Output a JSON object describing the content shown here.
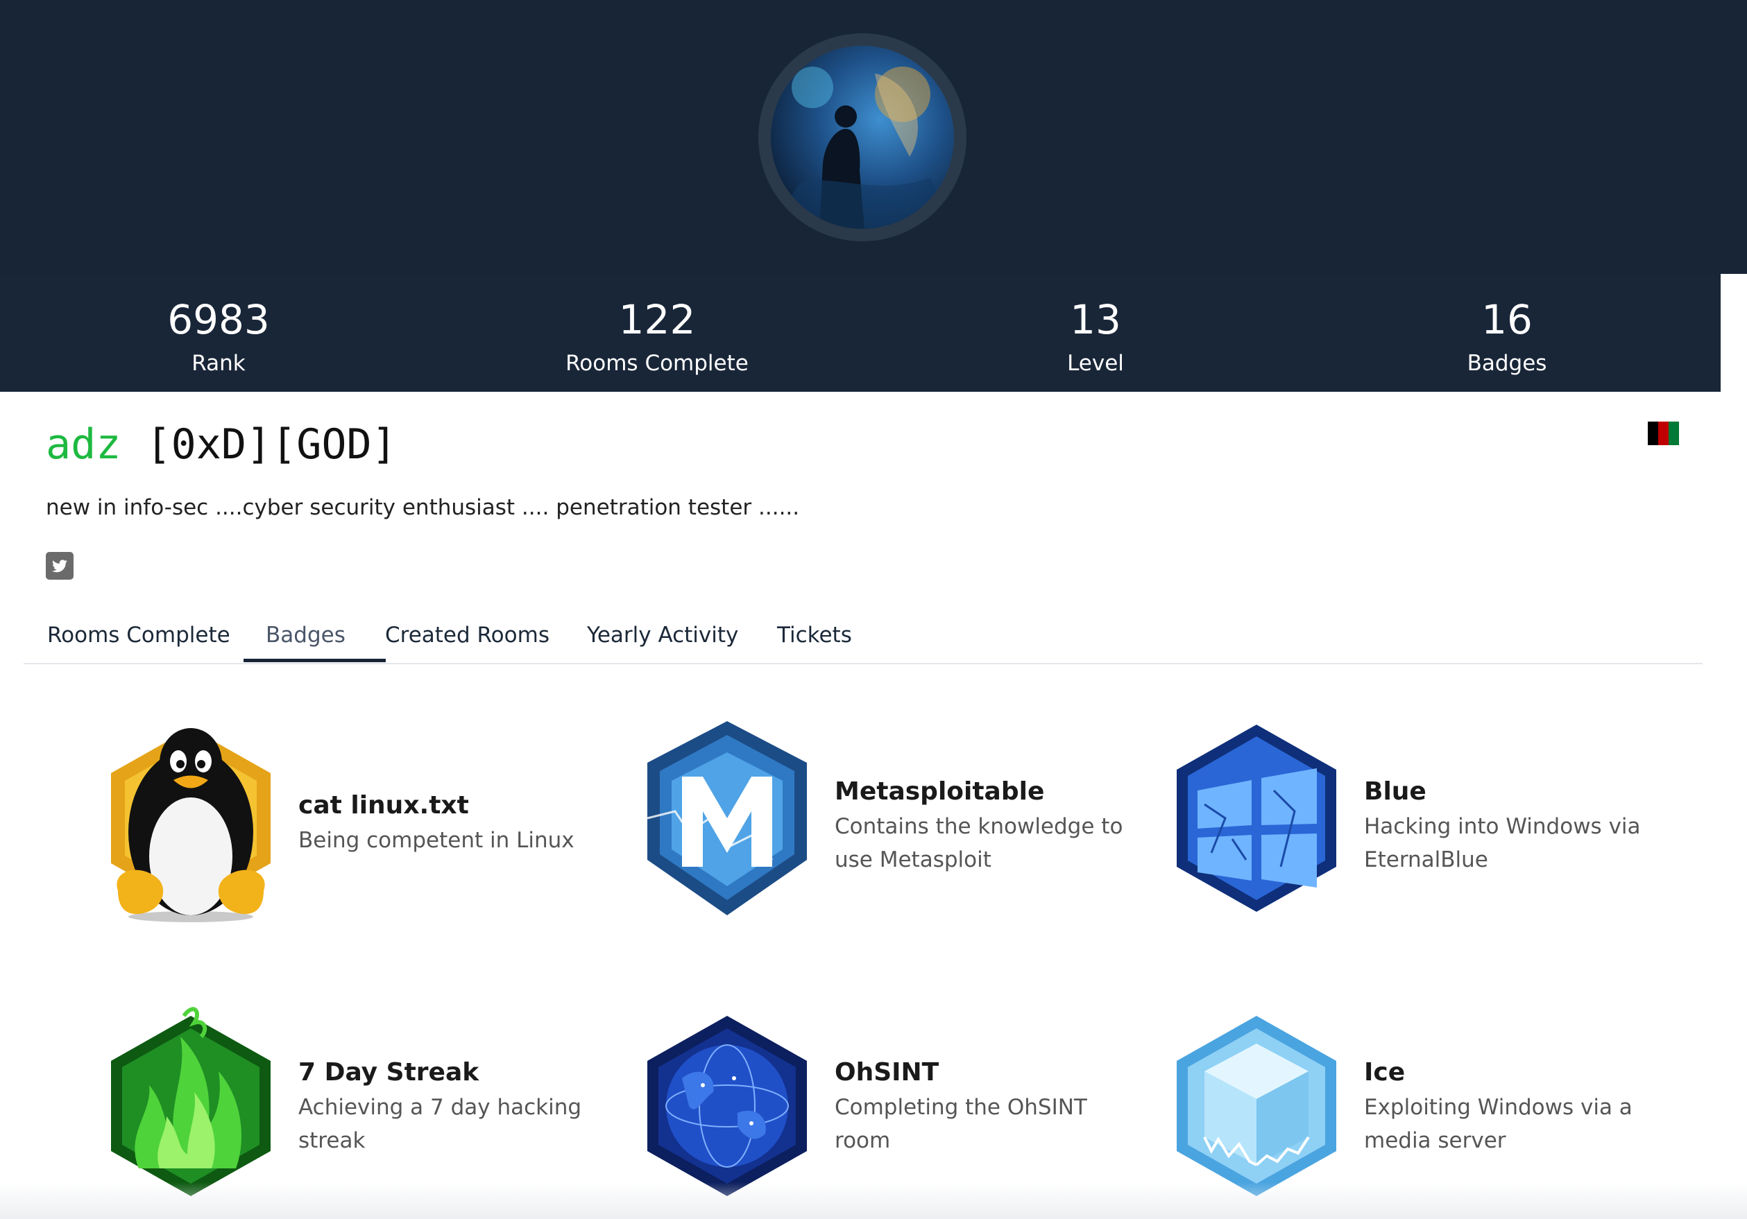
{
  "profile": {
    "username": "adz",
    "tag": "[0xD][GOD]",
    "bio": "new in info-sec ....cyber security enthusiast .... penetration tester ......",
    "country_flag": "flag-icon",
    "social_icon": "twitter-icon"
  },
  "stats": [
    {
      "value": "6983",
      "label": "Rank"
    },
    {
      "value": "122",
      "label": "Rooms Complete"
    },
    {
      "value": "13",
      "label": "Level"
    },
    {
      "value": "16",
      "label": "Badges"
    }
  ],
  "tabs": [
    {
      "label": "Rooms Complete",
      "active": false
    },
    {
      "label": "Badges",
      "active": true
    },
    {
      "label": "Created Rooms",
      "active": false
    },
    {
      "label": "Yearly Activity",
      "active": false
    },
    {
      "label": "Tickets",
      "active": false
    }
  ],
  "badges": [
    {
      "title": "cat linux.txt",
      "description": "Being competent in Linux",
      "icon": "linux-penguin-icon"
    },
    {
      "title": "Metasploitable",
      "description": "Contains the knowledge to use Metasploit",
      "icon": "metasploit-icon"
    },
    {
      "title": "Blue",
      "description": "Hacking into Windows via EternalBlue",
      "icon": "blue-windows-icon"
    },
    {
      "title": "7 Day Streak",
      "description": "Achieving a 7 day hacking streak",
      "icon": "flame-icon"
    },
    {
      "title": "OhSINT",
      "description": "Completing the OhSINT room",
      "icon": "globe-icon"
    },
    {
      "title": "Ice",
      "description": "Exploiting Windows via a media server",
      "icon": "ice-cube-icon"
    }
  ],
  "colors": {
    "header_bg": "#172536",
    "username_accent": "#1db940",
    "tab_underline": "#172536"
  }
}
